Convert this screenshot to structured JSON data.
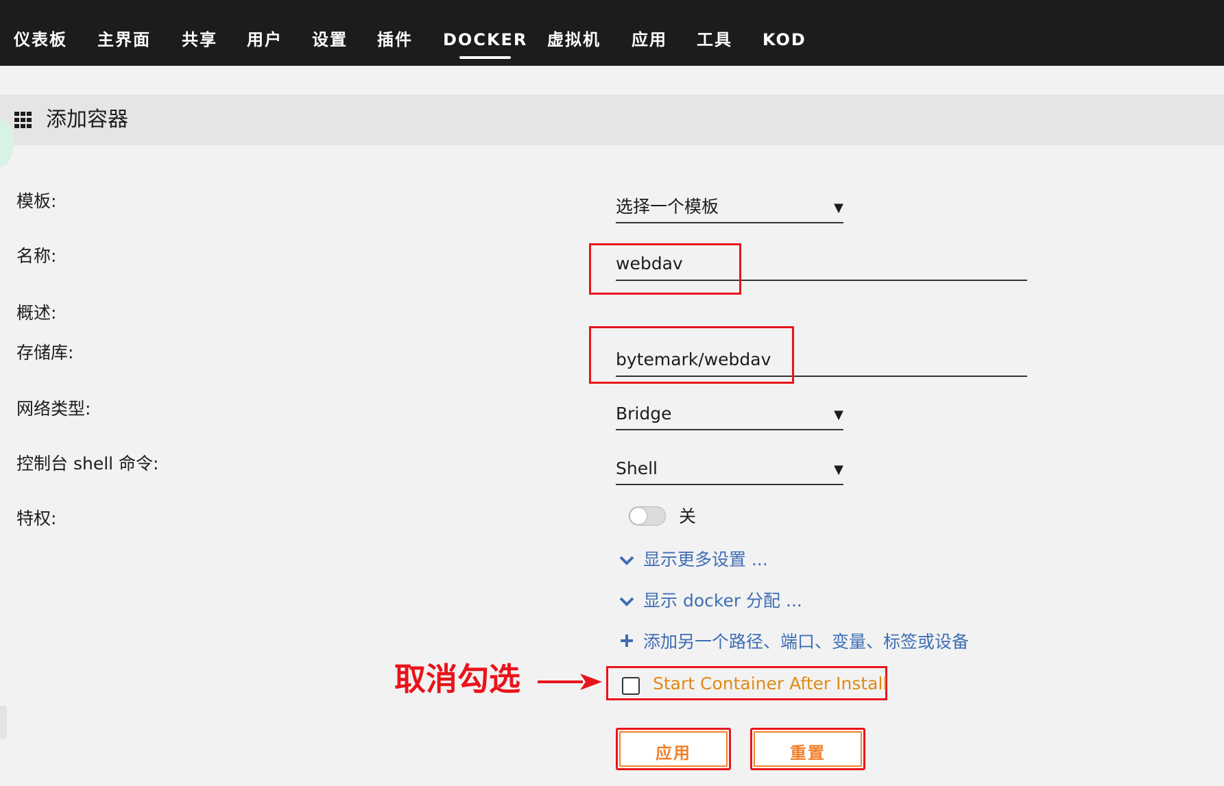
{
  "nav": {
    "items": [
      "仪表板",
      "主界面",
      "共享",
      "用户",
      "设置",
      "插件",
      "DOCKER",
      "虚拟机",
      "应用",
      "工具",
      "KOD"
    ],
    "active": "DOCKER"
  },
  "section": {
    "icon": "grid-icon",
    "title": "添加容器"
  },
  "form": {
    "template": {
      "label": "模板:",
      "value": "选择一个模板"
    },
    "name": {
      "label": "名称:",
      "value": "webdav"
    },
    "description": {
      "label": "概述:"
    },
    "repository": {
      "label": "存储库:",
      "value": "bytemark/webdav"
    },
    "network": {
      "label": "网络类型:",
      "value": "Bridge"
    },
    "console": {
      "label": "控制台 shell 命令:",
      "value": "Shell"
    },
    "privileged": {
      "label": "特权:",
      "toggle_text": "关",
      "checked": false
    }
  },
  "links": {
    "more_settings": "显示更多设置 ...",
    "docker_alloc": "显示 docker 分配 ...",
    "add_path": "添加另一个路径、端口、变量、标签或设备"
  },
  "start_after_install": {
    "label": "Start Container After Install",
    "checked": false
  },
  "annotation": {
    "text": "取消勾选"
  },
  "buttons": {
    "apply": "应用",
    "reset": "重置"
  },
  "colors": {
    "nav_bg": "#1c1c1c",
    "link": "#3d6db5",
    "accent_orange": "#f07f2a",
    "highlight_red": "#e8141b"
  }
}
